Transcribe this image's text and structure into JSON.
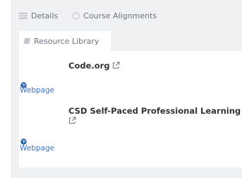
{
  "tabs": [
    {
      "label": "Details",
      "icon": "list-icon"
    },
    {
      "label": "Course Alignments",
      "icon": "circle-icon"
    }
  ],
  "resource_library": {
    "label": "Resource Library",
    "icon": "book-icon"
  },
  "resources": [
    {
      "title": "Code.org",
      "type": "Webpage"
    },
    {
      "title_line1": "CSD Self-Paced Professional Learning",
      "type": "Webpage"
    }
  ],
  "colors": {
    "link": "#3b74c4",
    "title": "#333333",
    "muted": "#6b7280",
    "background": "#f0f1f2"
  }
}
